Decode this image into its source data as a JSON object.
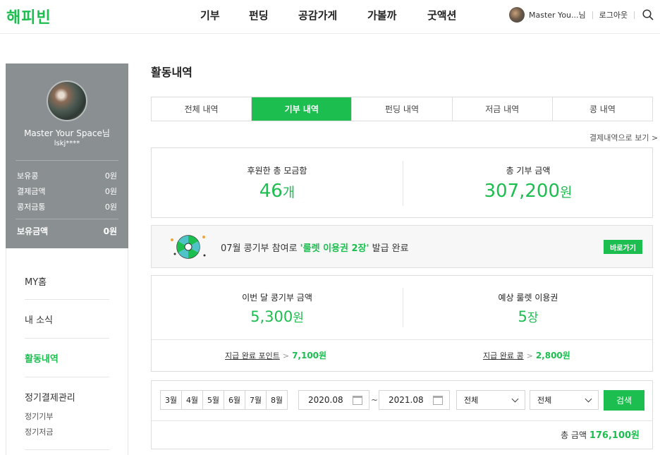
{
  "header": {
    "logo": "해피빈",
    "nav": [
      "기부",
      "펀딩",
      "공감가게",
      "가볼까",
      "굿액션"
    ],
    "user_name": "Master You...님",
    "logout": "로그아웃"
  },
  "profile": {
    "name": "Master Your Space님",
    "id": "lskj****",
    "rows": [
      {
        "label": "보유콩",
        "value": "0원"
      },
      {
        "label": "결제금액",
        "value": "0원"
      },
      {
        "label": "콩저금통",
        "value": "0원"
      }
    ],
    "total": {
      "label": "보유금액",
      "value": "0원"
    }
  },
  "menu": {
    "my_home": "MY홈",
    "news": "내 소식",
    "activity": "활동내역",
    "regular": "정기결제관리",
    "sub": [
      "정기기부",
      "정기저금"
    ]
  },
  "main": {
    "title": "활동내역",
    "tabs": [
      "전체 내역",
      "기부 내역",
      "펀딩 내역",
      "저금 내역",
      "콩 내역"
    ],
    "active_tab": 1,
    "pay_link": "결제내역으로 보기 >",
    "summary": {
      "left_label": "후원한 총 모금함",
      "left_value": "46",
      "left_unit": "개",
      "right_label": "총 기부 금액",
      "right_value": "307,200",
      "right_unit": "원"
    },
    "banner": {
      "prefix": "07월 콩기부 참여로 ",
      "highlight": "'룰렛 이용권 2장'",
      "suffix": " 발급 완료",
      "button": "바로가기"
    },
    "month": {
      "left_label": "이번 달 콩기부 금액",
      "left_value": "5,300",
      "left_unit": "원",
      "right_label": "예상 룰렛 이용권",
      "right_value": "5",
      "right_unit": "장",
      "foot_left_label": "지급 완료 포인트",
      "foot_left_value": "7,100원",
      "foot_right_label": "지급 완료 콩",
      "foot_right_value": "2,800원"
    },
    "filter": {
      "months": [
        "3월",
        "4월",
        "5월",
        "6월",
        "7월",
        "8월"
      ],
      "date_from": "2020.08",
      "tilde": "~",
      "date_to": "2021.08",
      "select1": "전체",
      "select2": "전체",
      "search": "검색",
      "total_label": "총 금액",
      "total_value": "176,100원"
    }
  }
}
